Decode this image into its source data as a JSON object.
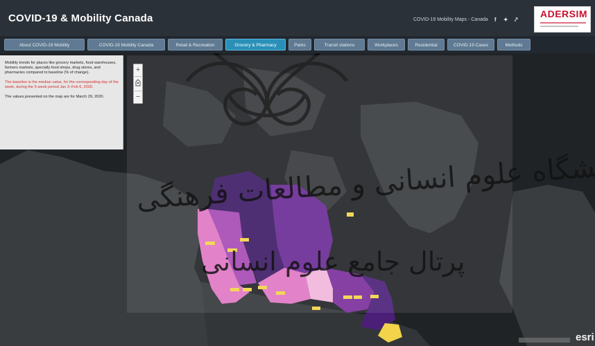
{
  "header": {
    "title": "COVID-19 & Mobility Canada",
    "subtitle_link": "COVID-19 Mobility Maps - Canada",
    "icons": [
      "facebook-icon",
      "twitter-icon",
      "share-icon"
    ],
    "logo_text": "ADERSIM"
  },
  "tabs": [
    {
      "label": "About COVID-19 Mobility"
    },
    {
      "label": "COVID-19 Mobility Canada"
    },
    {
      "label": "Retail & Recreation"
    },
    {
      "label": "Grocery & Pharmacy"
    },
    {
      "label": "Parks"
    },
    {
      "label": "Transit stations"
    },
    {
      "label": "Workplaces"
    },
    {
      "label": "Residential"
    },
    {
      "label": "COVID-19 Cases"
    },
    {
      "label": "Methods"
    }
  ],
  "active_tab": "Grocery & Pharmacy",
  "info_panel": {
    "p1": "Mobility trends for places like grocery markets, food warehouses, farmers markets, specialty food shops, drug stores, and pharmacies compared to baseline (% of change).",
    "p2": "The baseline is the median value, for the corresponding day of the week, during the 5-week period Jan 3–Feb 6, 2020.",
    "p3": "The values presented on the map are for March 29, 2020."
  },
  "map": {
    "zoom_in": "+",
    "zoom_out": "−",
    "provider": "esri",
    "colors": {
      "dark_purple": "#3d1b66",
      "purple": "#6a2a95",
      "magenta": "#a54ab5",
      "pink": "#e077c4",
      "light_pink": "#f0b6db",
      "label_yellow": "#f2d34a"
    }
  },
  "watermark": {
    "line1": "پژوهشگاه علوم انسانی و مطالعات فرهنگی",
    "line2": "پرتال جامع علوم انسانی"
  }
}
